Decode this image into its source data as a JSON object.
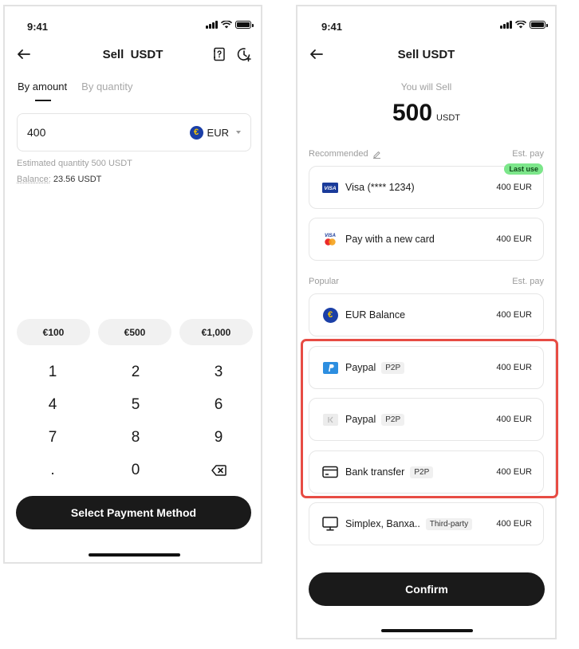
{
  "status_bar": {
    "time": "9:41"
  },
  "screen1": {
    "title": "Sell  USDT",
    "tabs": [
      {
        "label": "By amount",
        "active": true
      },
      {
        "label": "By quantity",
        "active": false
      }
    ],
    "amount_input": {
      "value": "400"
    },
    "currency": {
      "symbol": "€",
      "code": "EUR"
    },
    "estimated_label": "Estimated quantity 500 USDT",
    "balance_label": "Balance:",
    "balance_value": "23.56 USDT",
    "presets": [
      "€100",
      "€500",
      "€1,000"
    ],
    "keypad": [
      "1",
      "2",
      "3",
      "4",
      "5",
      "6",
      "7",
      "8",
      "9",
      ".",
      "0"
    ],
    "cta": "Select Payment Method"
  },
  "screen2": {
    "title": "Sell USDT",
    "you_will_sell": "You will Sell",
    "amount": "500",
    "unit": "USDT",
    "recommended_label": "Recommended",
    "popular_label": "Popular",
    "est_pay": "Est. pay",
    "last_use": "Last use",
    "recommended": [
      {
        "icon": "visa-icon",
        "name": "Visa (**** 1234)",
        "price": "400 EUR"
      },
      {
        "icon": "visa-mastercard-icon",
        "name": "Pay with a new card",
        "price": "400 EUR"
      }
    ],
    "popular": [
      {
        "icon": "euro-coin-icon",
        "name": "EUR Balance",
        "badge": "",
        "price": "400 EUR"
      },
      {
        "icon": "paypal-icon",
        "name": "Paypal",
        "badge": "P2P",
        "price": "400 EUR"
      },
      {
        "icon": "placeholder-logo-icon",
        "name": "Paypal",
        "badge": "P2P",
        "price": "400 EUR"
      },
      {
        "icon": "bank-card-icon",
        "name": "Bank transfer",
        "badge": "P2P",
        "price": "400 EUR"
      },
      {
        "icon": "monitor-icon",
        "name": "Simplex, Banxa..",
        "badge": "Third-party",
        "price": "400 EUR"
      }
    ],
    "cta": "Confirm"
  },
  "colors": {
    "primary": "#1a1a1a",
    "muted_text": "#a0a0a0",
    "highlight": "#e74c44",
    "last_use_bg": "#7ce68a",
    "euro_blue": "#1b3fa7"
  }
}
